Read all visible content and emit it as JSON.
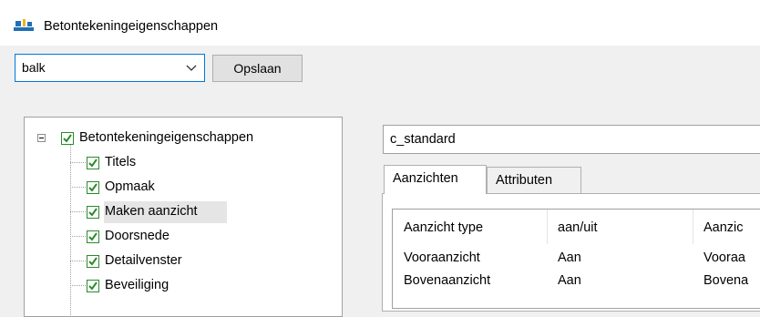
{
  "window": {
    "title": "Betontekeningeigenschappen"
  },
  "toolbar": {
    "preset_value": "balk",
    "save_label": "Opslaan"
  },
  "tree": {
    "root_label": "Betontekeningeigenschappen",
    "items": [
      {
        "label": "Titels",
        "checked": true
      },
      {
        "label": "Opmaak",
        "checked": true
      },
      {
        "label": "Maken aanzicht",
        "checked": true,
        "selected": true
      },
      {
        "label": "Doorsnede",
        "checked": true
      },
      {
        "label": "Detailvenster",
        "checked": true
      },
      {
        "label": "Beveiliging",
        "checked": true
      }
    ]
  },
  "name_field": {
    "value": "c_standard"
  },
  "tabs": [
    {
      "label": "Aanzichten",
      "active": true
    },
    {
      "label": "Attributen",
      "active": false
    }
  ],
  "grid": {
    "headers": [
      "Aanzicht type",
      "aan/uit",
      "Aanzic"
    ],
    "rows": [
      [
        "Vooraanzicht",
        "Aan",
        "Vooraa"
      ],
      [
        "Bovenaanzicht",
        "Aan",
        "Bovena"
      ]
    ]
  },
  "colors": {
    "accent": "#0078d7",
    "check": "#2a8a2a",
    "selection": "#e5e5e5"
  }
}
